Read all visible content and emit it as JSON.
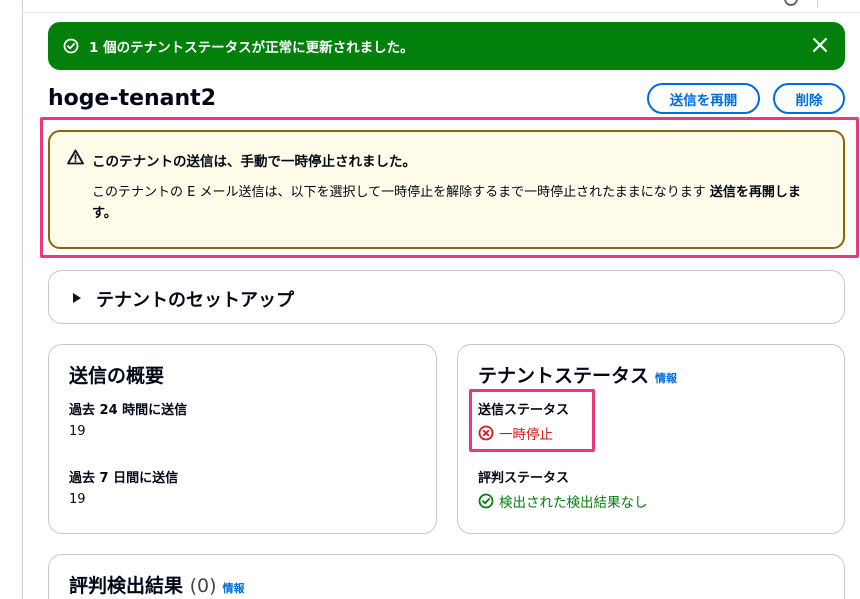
{
  "flash": {
    "message": "1 個のテナントステータスが正常に更新されました。",
    "color": "#037f0c"
  },
  "header": {
    "title": "hoge-tenant2",
    "resume_label": "送信を再開",
    "delete_label": "削除"
  },
  "alert": {
    "title": "このテナントの送信は、手動で一時停止されました。",
    "body": "このテナントの E メール送信は、以下を選択して一時停止を解除するまで一時停止されたままになります ",
    "body_bold": "送信を再開します。"
  },
  "setup": {
    "label": "テナントのセットアップ"
  },
  "summary": {
    "title": "送信の概要",
    "last24_label": "過去 24 時間に送信",
    "last24_value": "19",
    "last7_label": "過去 7 日間に送信",
    "last7_value": "19"
  },
  "status": {
    "title": "テナントステータス",
    "info": "情報",
    "sending_label": "送信ステータス",
    "sending_value": "一時停止",
    "reputation_label": "評判ステータス",
    "reputation_value": "検出された検出結果なし"
  },
  "reputation_findings": {
    "title": "評判検出結果",
    "count": "(0)",
    "info": "情報"
  },
  "icons": {
    "flash": "check-circle-icon",
    "close": "close-icon",
    "alert": "warning-icon",
    "paused": "x-circle-icon",
    "ok": "check-circle-icon",
    "expand": "caret-right-icon"
  }
}
